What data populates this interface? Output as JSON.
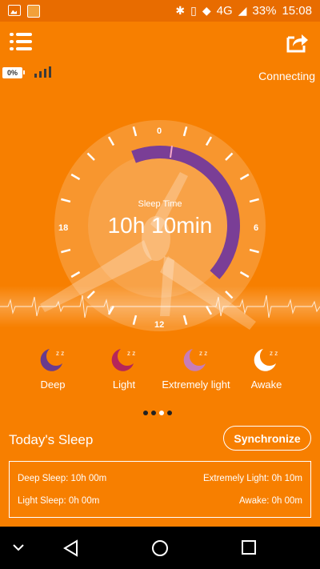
{
  "status_bar": {
    "network": "4G",
    "battery": "33%",
    "time": "15:08"
  },
  "device": {
    "battery_level": "0%",
    "connection_status": "Connecting"
  },
  "dial": {
    "label": "Sleep Time",
    "value": "10h 10min",
    "hour_labels": [
      "0",
      "6",
      "12",
      "18"
    ],
    "arc_color": "#7a3e96"
  },
  "legend": [
    {
      "label": "Deep",
      "moon_color": "#6a3b8c"
    },
    {
      "label": "Light",
      "moon_color": "#b5265a"
    },
    {
      "label": "Extremely light",
      "moon_color": "#c77db8"
    },
    {
      "label": "Awake",
      "moon_color": "#ffffff"
    }
  ],
  "pager": {
    "pages": 4,
    "active_index": 2
  },
  "today": {
    "title": "Today's Sleep",
    "sync_label": "Synchronize",
    "deep": "Deep Sleep: 10h 00m",
    "extremely_light": "Extremely Light: 0h 10m",
    "light": "Light Sleep: 0h 00m",
    "awake": "Awake: 0h 00m"
  },
  "colors": {
    "accent": "#f77f00",
    "status_bar": "#e86c00"
  }
}
